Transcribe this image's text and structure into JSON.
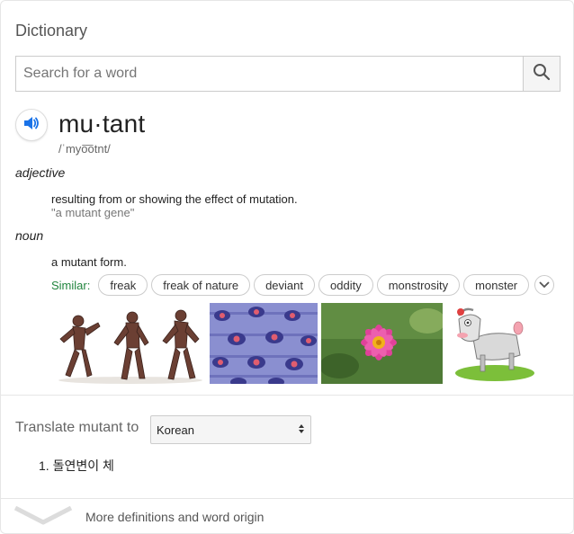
{
  "header": {
    "title": "Dictionary"
  },
  "search": {
    "placeholder": "Search for a word"
  },
  "entry": {
    "word": "mu·tant",
    "phonetic": "/ˈmyo͞otnt/",
    "senses": [
      {
        "part_of_speech": "adjective",
        "definition": "resulting from or showing the effect of mutation.",
        "example": "\"a mutant gene\""
      },
      {
        "part_of_speech": "noun",
        "definition": "a mutant form."
      }
    ],
    "similar_label": "Similar:",
    "similar": [
      "freak",
      "freak of nature",
      "deviant",
      "oddity",
      "monstrosity",
      "monster"
    ]
  },
  "images": [
    "zombie-figures",
    "peacock-feather-pattern",
    "pink-dahlia-flower",
    "cartoon-goat"
  ],
  "translate": {
    "label": "Translate mutant to",
    "language": "Korean",
    "results": [
      "1. 돌연변이 체"
    ]
  },
  "footer": {
    "more_label": "More definitions and word origin"
  },
  "colors": {
    "accent_blue": "#1a73e8",
    "similar_green": "#21853e"
  }
}
